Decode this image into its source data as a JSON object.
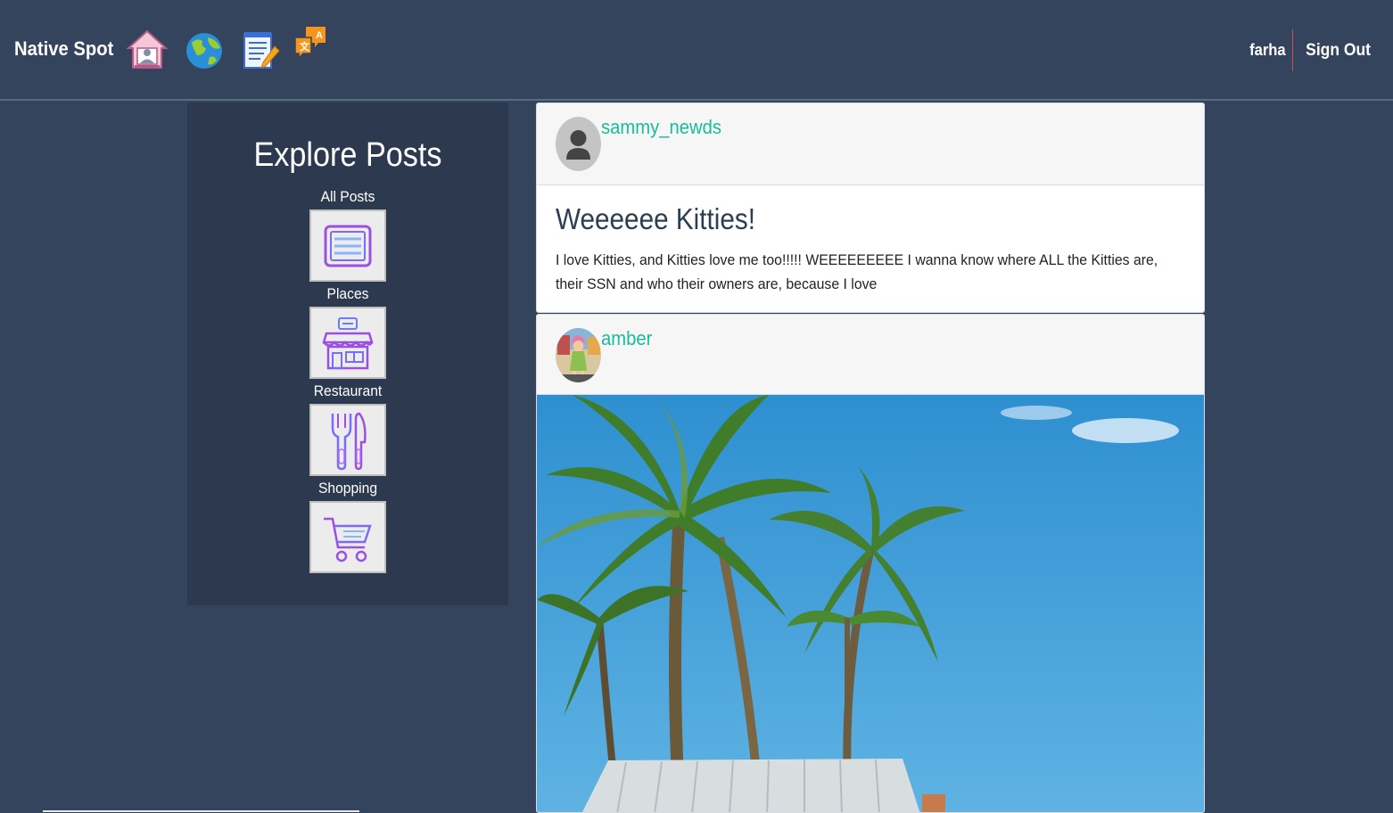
{
  "navbar": {
    "brand": "Native Spot",
    "icons": [
      "home-icon",
      "globe-icon",
      "notepad-icon",
      "chat-icon"
    ],
    "username": "farha",
    "signout_label": "Sign Out"
  },
  "sidebar": {
    "title": "Explore Posts",
    "categories": [
      {
        "label": "All Posts",
        "icon": "list-icon"
      },
      {
        "label": "Places",
        "icon": "store-icon"
      },
      {
        "label": "Restaurant",
        "icon": "fork-knife-icon"
      },
      {
        "label": "Shopping",
        "icon": "cart-icon"
      }
    ]
  },
  "posts": [
    {
      "author": "sammy_newds",
      "avatar": "default-user-icon",
      "title": "Weeeeee Kitties!",
      "text": "I love Kitties, and Kitties love me too!!!!! WEEEEEEEEE I wanna know where ALL the Kitties are, their SSN and who their owners are, because I love"
    },
    {
      "author": "amber",
      "avatar": "cartoon-avatar",
      "image": "palm-tree-beach-photo"
    }
  ],
  "colors": {
    "background": "#34445c",
    "sidebar": "#2c394f",
    "author": "#1abc9c",
    "icon_purple": "#8a4cf0"
  }
}
